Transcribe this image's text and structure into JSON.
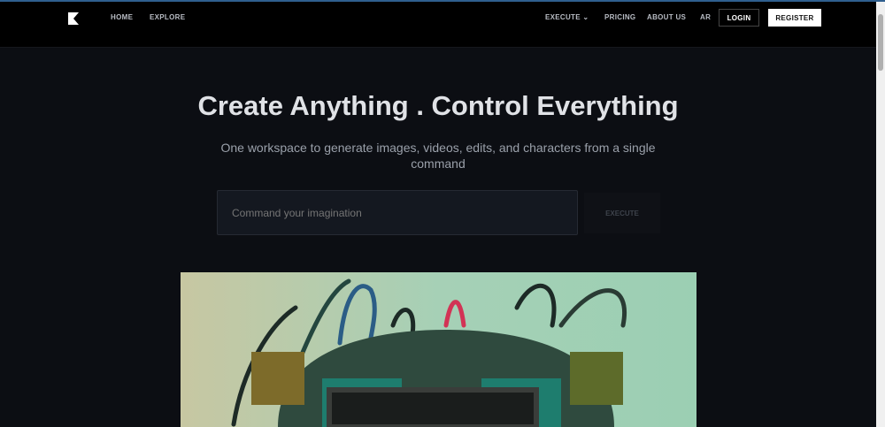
{
  "nav": {
    "home": "HOME",
    "explore": "EXPLORE",
    "execute": "EXECUTE",
    "pricing": "PRICING",
    "about": "ABOUT US",
    "lang": "AR",
    "login": "LOGIN",
    "register": "REGISTER"
  },
  "hero": {
    "title": "Create Anything . Control Everything",
    "subtitle": "One workspace to generate images, videos, edits, and characters from a single command",
    "placeholder": "Command your imagination",
    "execute_button": "EXECUTE"
  }
}
